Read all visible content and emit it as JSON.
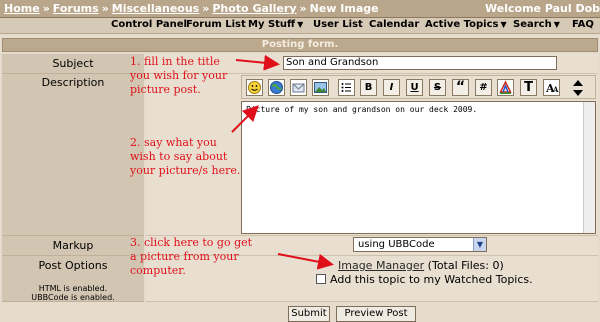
{
  "breadcrumb": {
    "items": [
      "Home",
      "Forums",
      "Miscellaneous",
      "Photo Gallery"
    ],
    "current": "New Image",
    "separator": "»"
  },
  "welcome": "Welcome Paul Dob",
  "nav": {
    "items": [
      "Control Panel",
      "Forum List",
      "My Stuff",
      "User List",
      "Calendar",
      "Active Topics",
      "Search",
      "FAQ"
    ]
  },
  "form": {
    "header": "Posting form.",
    "subject_label": "Subject",
    "subject_value": "Son and Grandson",
    "description_label": "Description",
    "description_text": "Picture of my son and grandson on our deck 2009.",
    "markup_label": "Markup",
    "markup_value": "using UBBCode",
    "post_options_label": "Post Options",
    "html_status": "HTML is enabled.",
    "ubbcode_status": "UBBCode is enabled.",
    "image_manager_link": "Image Manager",
    "total_files": "(Total Files: 0)",
    "watch_label": "Add this topic to my Watched Topics.",
    "submit_label": "Submit",
    "preview_label": "Preview Post"
  },
  "toolbar": {
    "buttons": [
      "B",
      "I",
      "U",
      "S",
      "“",
      "#",
      "T"
    ]
  },
  "annotations": {
    "step1": [
      "1. fill in the title",
      "you wish for your",
      "picture post."
    ],
    "step2": [
      "2. say what you",
      "wish to say about",
      "your picture/s here."
    ],
    "step3": [
      "3. click here to go get",
      "a picture from your",
      "computer."
    ]
  },
  "colors": {
    "topbar": "#b9a68a",
    "annotation": "#e0101a"
  }
}
